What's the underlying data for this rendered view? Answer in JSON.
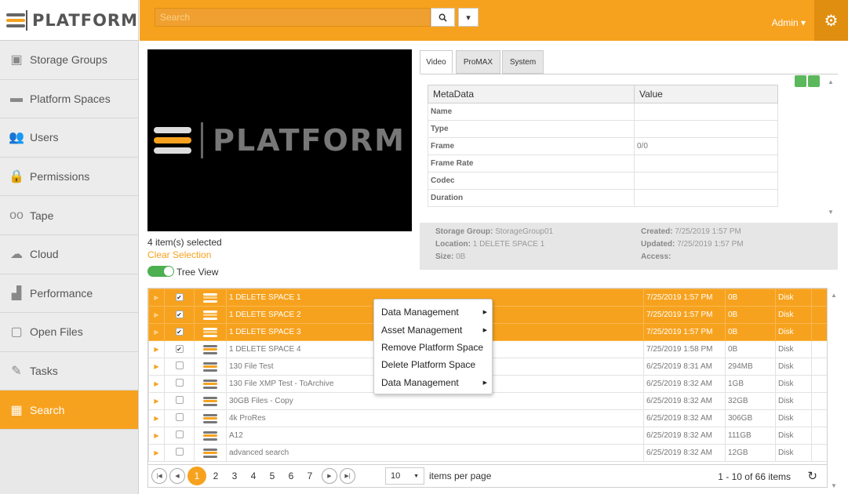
{
  "app": {
    "logo_text": "PLATFORM"
  },
  "sidebar": {
    "items": [
      {
        "label": "Storage Groups",
        "icon": "storage-icon"
      },
      {
        "label": "Platform Spaces",
        "icon": "monitor-icon"
      },
      {
        "label": "Users",
        "icon": "users-icon"
      },
      {
        "label": "Permissions",
        "icon": "lock-icon"
      },
      {
        "label": "Tape",
        "icon": "tape-icon"
      },
      {
        "label": "Cloud",
        "icon": "cloud-icon"
      },
      {
        "label": "Performance",
        "icon": "bar-chart-icon"
      },
      {
        "label": "Open Files",
        "icon": "open-file-icon"
      },
      {
        "label": "Tasks",
        "icon": "tasks-icon"
      },
      {
        "label": "Search",
        "icon": "search-grid-icon",
        "active": true
      }
    ]
  },
  "topbar": {
    "search_placeholder": "Search",
    "user_label": "Admin"
  },
  "preview": {
    "logo_text": "PLATFORM"
  },
  "selection": {
    "count_label": "4 item(s) selected",
    "clear_label": "Clear Selection",
    "tree_view_label": "Tree View",
    "tree_view_on": true
  },
  "metadata": {
    "tabs": [
      "Video",
      "ProMAX",
      "System"
    ],
    "active_tab": "Video",
    "headers": [
      "MetaData",
      "Value"
    ],
    "rows": [
      {
        "key": "Name",
        "value": ""
      },
      {
        "key": "Type",
        "value": ""
      },
      {
        "key": "Frame",
        "value": "0/0"
      },
      {
        "key": "Frame Rate",
        "value": ""
      },
      {
        "key": "Codec",
        "value": ""
      },
      {
        "key": "Duration",
        "value": ""
      }
    ]
  },
  "info": {
    "storage_group_label": "Storage Group:",
    "storage_group": "StorageGroup01",
    "location_label": "Location:",
    "location": "1 DELETE SPACE 1",
    "size_label": "Size:",
    "size": "0B",
    "created_label": "Created:",
    "created": "7/25/2019 1:57 PM",
    "updated_label": "Updated:",
    "updated": "7/25/2019 1:57 PM",
    "access_label": "Access:",
    "access": ""
  },
  "files": [
    {
      "name": "1 DELETE SPACE 1",
      "date": "7/25/2019 1:57 PM",
      "size": "0B",
      "type": "Disk",
      "checked": true,
      "selected": true
    },
    {
      "name": "1 DELETE SPACE 2",
      "date": "7/25/2019 1:57 PM",
      "size": "0B",
      "type": "Disk",
      "checked": true,
      "selected": true
    },
    {
      "name": "1 DELETE SPACE 3",
      "date": "7/25/2019 1:57 PM",
      "size": "0B",
      "type": "Disk",
      "checked": true,
      "selected": true
    },
    {
      "name": "1 DELETE SPACE 4",
      "date": "7/25/2019 1:58 PM",
      "size": "0B",
      "type": "Disk",
      "checked": true,
      "selected": false
    },
    {
      "name": "130 File Test",
      "date": "6/25/2019 8:31 AM",
      "size": "294MB",
      "type": "Disk",
      "checked": false,
      "selected": false
    },
    {
      "name": "130 File XMP Test - ToArchive",
      "date": "6/25/2019 8:32 AM",
      "size": "1GB",
      "type": "Disk",
      "checked": false,
      "selected": false
    },
    {
      "name": "30GB Files - Copy",
      "date": "6/25/2019 8:32 AM",
      "size": "32GB",
      "type": "Disk",
      "checked": false,
      "selected": false
    },
    {
      "name": "4k ProRes",
      "date": "6/25/2019 8:32 AM",
      "size": "306GB",
      "type": "Disk",
      "checked": false,
      "selected": false
    },
    {
      "name": "A12",
      "date": "6/25/2019 8:32 AM",
      "size": "111GB",
      "type": "Disk",
      "checked": false,
      "selected": false
    },
    {
      "name": "advanced search",
      "date": "6/25/2019 8:32 AM",
      "size": "12GB",
      "type": "Disk",
      "checked": false,
      "selected": false
    }
  ],
  "context_menu": {
    "items": [
      {
        "label": "Data Management",
        "submenu": true
      },
      {
        "label": "Asset Management",
        "submenu": true
      },
      {
        "label": "Remove Platform Space",
        "submenu": false
      },
      {
        "label": "Delete Platform Space",
        "submenu": false
      },
      {
        "label": "Data Management",
        "submenu": true
      }
    ]
  },
  "pagination": {
    "pages": [
      "1",
      "2",
      "3",
      "4",
      "5",
      "6",
      "7"
    ],
    "current_page": "1",
    "page_size": "10",
    "per_page_label": "items per page",
    "summary": "1 - 10 of 66 items"
  },
  "colors": {
    "accent": "#f7a21e",
    "toggle": "#4caf50"
  }
}
